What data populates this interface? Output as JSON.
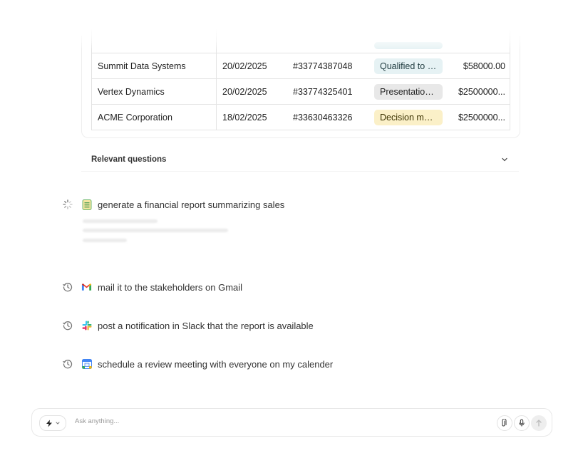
{
  "table": {
    "rows": [
      {
        "company": "Summit Data Systems",
        "date": "20/02/2025",
        "id": "#33774387048",
        "stage": "Qualified to b...",
        "stage_color": "#e6f2f4",
        "amount": "$58000.00"
      },
      {
        "company": "Vertex Dynamics",
        "date": "20/02/2025",
        "id": "#33774325401",
        "stage": "Presentation ...",
        "stage_color": "#e8e8e8",
        "amount": "$2500000..."
      },
      {
        "company": "ACME Corporation",
        "date": "18/02/2025",
        "id": "#33630463326",
        "stage": "Decision mak...",
        "stage_color": "#fbf0c8",
        "amount": "$2500000..."
      }
    ]
  },
  "relevant_questions": {
    "label": "Relevant questions",
    "icon": "chevron-down-icon"
  },
  "tasks": [
    {
      "status": "loading",
      "app_icon": "sheets-icon",
      "text": "generate a financial report summarizing sales"
    },
    {
      "status": "pending",
      "app_icon": "gmail-icon",
      "text": "mail it to the stakeholders on Gmail"
    },
    {
      "status": "pending",
      "app_icon": "slack-icon",
      "text": "post a notification in Slack that the report is available"
    },
    {
      "status": "pending",
      "app_icon": "calendar-icon",
      "text": "schedule a review meeting with everyone on my calender"
    }
  ],
  "composer": {
    "placeholder": "Ask anything...",
    "mode_icon": "lightning-icon",
    "attach_icon": "paperclip-icon",
    "mic_icon": "microphone-icon",
    "send_icon": "arrow-up-icon"
  }
}
